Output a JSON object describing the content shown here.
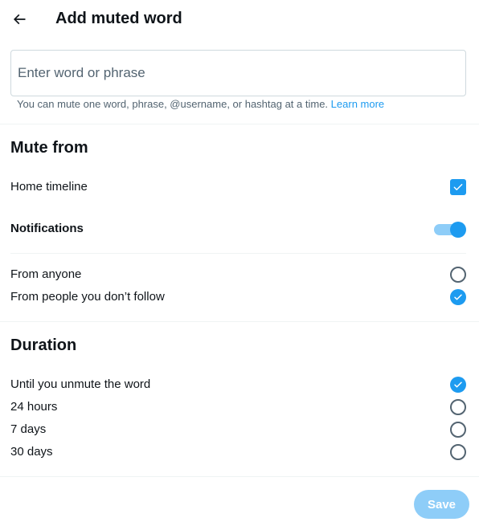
{
  "header": {
    "title": "Add muted word"
  },
  "input": {
    "placeholder": "Enter word or phrase",
    "value": ""
  },
  "hint": {
    "text": "You can mute one word, phrase, @username, or hashtag at a time. ",
    "link": "Learn more"
  },
  "mute_from": {
    "title": "Mute from",
    "home_timeline": {
      "label": "Home timeline",
      "checked": true
    },
    "notifications": {
      "label": "Notifications",
      "enabled": true
    },
    "audience": [
      {
        "label": "From anyone",
        "selected": false
      },
      {
        "label": "From people you don’t follow",
        "selected": true
      }
    ]
  },
  "duration": {
    "title": "Duration",
    "options": [
      {
        "label": "Until you unmute the word",
        "selected": true
      },
      {
        "label": "24 hours",
        "selected": false
      },
      {
        "label": "7 days",
        "selected": false
      },
      {
        "label": "30 days",
        "selected": false
      }
    ]
  },
  "footer": {
    "save_label": "Save"
  },
  "icons": {
    "back": "back-arrow-icon",
    "check": "checkmark-icon"
  },
  "colors": {
    "accent": "#1d9bf0",
    "accent_disabled": "#8ecdf8",
    "text_primary": "#0f1419",
    "text_secondary": "#536471",
    "border": "#cfd9de",
    "divider": "#eff3f4"
  }
}
